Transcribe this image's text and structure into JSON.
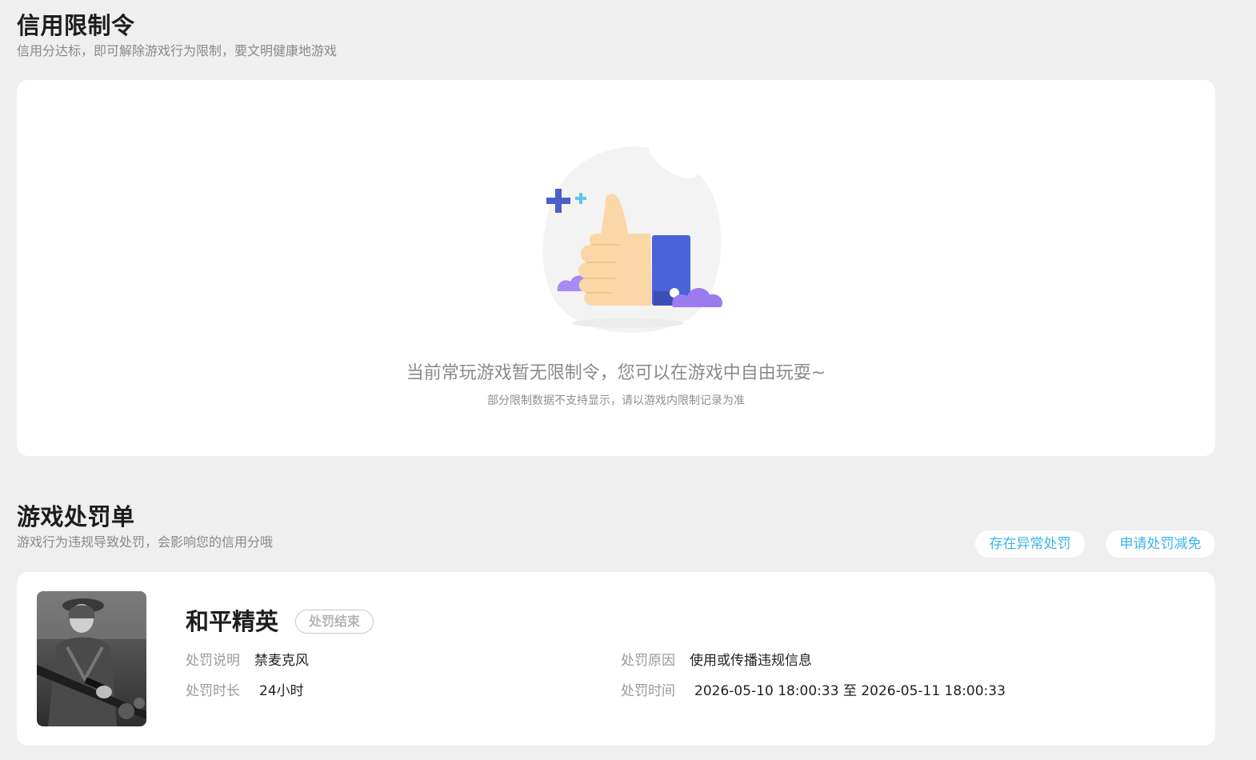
{
  "credit": {
    "title": "信用限制令",
    "subtitle": "信用分达标，即可解除游戏行为限制，要文明健康地游戏",
    "empty_main": "当前常玩游戏暂无限制令，您可以在游戏中自由玩耍~",
    "empty_sub": "部分限制数据不支持显示，请以游戏内限制记录为准"
  },
  "penalty": {
    "title": "游戏处罚单",
    "subtitle": "游戏行为违规导致处罚，会影响您的信用分哦",
    "btn_abnormal": "存在异常处罚",
    "btn_reduce": "申请处罚减免",
    "record": {
      "game_name": "和平精英",
      "status": "处罚结束",
      "desc_label": "处罚说明",
      "desc_value": "禁麦克风",
      "duration_label": "处罚时长",
      "duration_value": "24小时",
      "reason_label": "处罚原因",
      "reason_value": "使用或传播违规信息",
      "time_label": "处罚时间",
      "time_value": "2026-05-10 18:00:33 至 2026-05-11 18:00:33"
    }
  },
  "colors": {
    "accent": "#3bb4ea",
    "background": "#efefef",
    "card": "#ffffff",
    "thumb_blue": "#4a63d8",
    "cloud_purple": "#9b7cf0"
  }
}
